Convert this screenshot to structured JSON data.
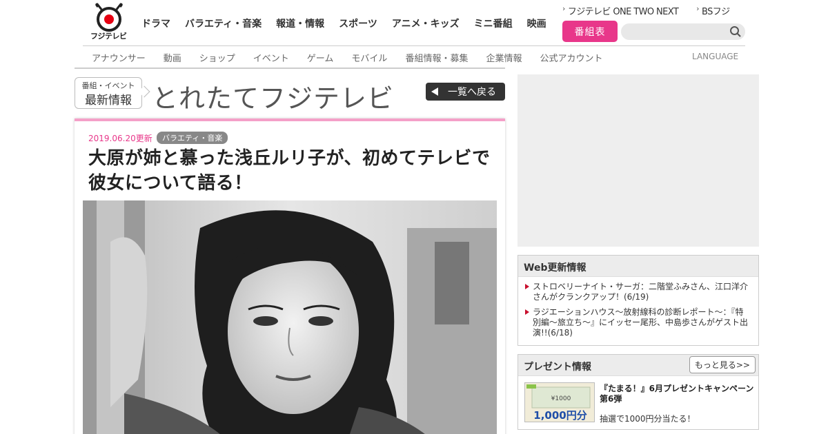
{
  "header": {
    "logo_text": "フジテレビ",
    "main_nav": [
      "ドラマ",
      "バラエティ・音楽",
      "報道・情報",
      "スポーツ",
      "アニメ・キッズ",
      "ミニ番組",
      "映画"
    ],
    "top_links": [
      "フジテレビ ONE TWO NEXT",
      "BSフジ"
    ],
    "bangumi_label": "番組表",
    "search_placeholder": "",
    "sub_nav": [
      "アナウンサー",
      "動画",
      "ショップ",
      "イベント",
      "ゲーム",
      "モバイル",
      "番組情報・募集",
      "企業情報",
      "公式アカウント"
    ],
    "language_label": "LANGUAGE"
  },
  "title_strip": {
    "badge_line1": "番組・イベント",
    "badge_line2": "最新情報",
    "page_title": "とれたてフジテレビ",
    "back_label": "一覧へ戻る"
  },
  "article": {
    "date": "2019.06.20更新",
    "category": "バラエティ・音楽",
    "headline": "大原が姉と慕った浅丘ルリ子が、初めてテレビで彼女について語る！"
  },
  "sidebar": {
    "web_update": {
      "heading": "Web更新情報",
      "items": [
        "ストロベリーナイト・サーガ：二階堂ふみさん、江口洋介さんがクランクアップ！(6/19)",
        "ラジエーションハウス～放射線科の診断レポート～：『特別編～旅立ち～』にイッセー尾形、中島歩さんがゲスト出演!!(6/18)"
      ]
    },
    "present": {
      "heading": "プレゼント情報",
      "more_label": "もっと見る>>",
      "item_title": "『たまる！』6月プレゼントキャンペーン第6弾",
      "item_desc": "抽選で1000円分当たる！",
      "thumb_amount": "1,000円分",
      "thumb_small": "¥1000"
    }
  },
  "colors": {
    "accent_pink": "#e8378a",
    "article_top_border": "#f4a0c8",
    "back_button": "#333333",
    "news_marker": "#c8102e"
  }
}
